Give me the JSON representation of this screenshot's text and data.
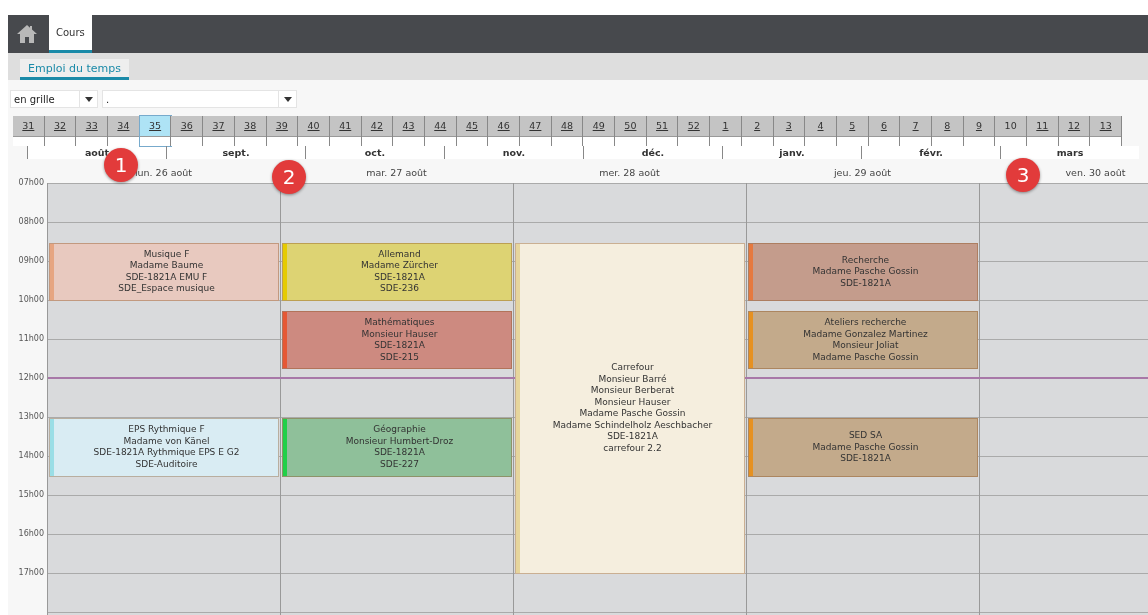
{
  "nav": {
    "tabs": [
      {
        "label": "Cours",
        "selected": true
      }
    ]
  },
  "subtabs": [
    {
      "label": "Emploi du temps",
      "selected": true
    }
  ],
  "filters": [
    {
      "value": "en grille"
    },
    {
      "value": "."
    }
  ],
  "weeks": [
    {
      "label": "31",
      "selected": false,
      "linked": true
    },
    {
      "label": "32",
      "selected": false,
      "linked": true
    },
    {
      "label": "33",
      "selected": false,
      "linked": true
    },
    {
      "label": "34",
      "selected": false,
      "linked": true
    },
    {
      "label": "35",
      "selected": true,
      "linked": true
    },
    {
      "label": "36",
      "selected": false,
      "linked": true
    },
    {
      "label": "37",
      "selected": false,
      "linked": true
    },
    {
      "label": "38",
      "selected": false,
      "linked": true
    },
    {
      "label": "39",
      "selected": false,
      "linked": true
    },
    {
      "label": "40",
      "selected": false,
      "linked": true
    },
    {
      "label": "41",
      "selected": false,
      "linked": true
    },
    {
      "label": "42",
      "selected": false,
      "linked": true
    },
    {
      "label": "43",
      "selected": false,
      "linked": true
    },
    {
      "label": "44",
      "selected": false,
      "linked": true
    },
    {
      "label": "45",
      "selected": false,
      "linked": true
    },
    {
      "label": "46",
      "selected": false,
      "linked": true
    },
    {
      "label": "47",
      "selected": false,
      "linked": true
    },
    {
      "label": "48",
      "selected": false,
      "linked": true
    },
    {
      "label": "49",
      "selected": false,
      "linked": true
    },
    {
      "label": "50",
      "selected": false,
      "linked": true
    },
    {
      "label": "51",
      "selected": false,
      "linked": true
    },
    {
      "label": "52",
      "selected": false,
      "linked": true
    },
    {
      "label": "1",
      "selected": false,
      "linked": true
    },
    {
      "label": "2",
      "selected": false,
      "linked": true
    },
    {
      "label": "3",
      "selected": false,
      "linked": true
    },
    {
      "label": "4",
      "selected": false,
      "linked": true
    },
    {
      "label": "5",
      "selected": false,
      "linked": true
    },
    {
      "label": "6",
      "selected": false,
      "linked": true
    },
    {
      "label": "7",
      "selected": false,
      "linked": true
    },
    {
      "label": "8",
      "selected": false,
      "linked": true
    },
    {
      "label": "9",
      "selected": false,
      "linked": true
    },
    {
      "label": "10",
      "selected": false,
      "linked": false
    },
    {
      "label": "11",
      "selected": false,
      "linked": true
    },
    {
      "label": "12",
      "selected": false,
      "linked": true
    },
    {
      "label": "13",
      "selected": false,
      "linked": true
    }
  ],
  "months": [
    "août",
    "sept.",
    "oct.",
    "nov.",
    "déc.",
    "janv.",
    "févr.",
    "mars"
  ],
  "hours": [
    "07h00",
    "08h00",
    "09h00",
    "10h00",
    "11h00",
    "12h00",
    "13h00",
    "14h00",
    "15h00",
    "16h00",
    "17h00"
  ],
  "days": [
    {
      "label": "lun. 26 août",
      "events": [
        {
          "color": "#e8c9bf",
          "lines": [
            "Musique F",
            "Madame Baume",
            "SDE-1821A EMU F",
            "SDE_Espace musique"
          ]
        },
        {
          "color": "#d9ecf3",
          "lines": [
            "EPS Rythmique F",
            "Madame von Känel",
            "SDE-1821A Rythmique EPS E G2",
            "SDE-Auditoire"
          ]
        }
      ]
    },
    {
      "label": "mar. 27 août",
      "events": [
        {
          "color": "#ddd373",
          "lines": [
            "Allemand",
            "Madame Zürcher",
            "SDE-1821A",
            "SDE-236"
          ]
        },
        {
          "color": "#cd8a80",
          "lines": [
            "Mathématiques",
            "Monsieur Hauser",
            "SDE-1821A",
            "SDE-215"
          ]
        },
        {
          "color": "#8fc09a",
          "lines": [
            "Géographie",
            "Monsieur Humbert-Droz",
            "SDE-1821A",
            "SDE-227"
          ]
        }
      ]
    },
    {
      "label": "mer. 28 août",
      "events": [
        {
          "color": "#f5eede",
          "lines": [
            "Carrefour",
            "Monsieur Barré",
            "Monsieur Berberat",
            "Monsieur Hauser",
            "Madame Pasche Gossin",
            "Madame Schindelholz Aeschbacher",
            "SDE-1821A",
            "carrefour 2.2"
          ]
        }
      ]
    },
    {
      "label": "jeu. 29 août",
      "events": [
        {
          "color": "#c49c8c",
          "lines": [
            "Recherche",
            "Madame Pasche Gossin",
            "SDE-1821A"
          ]
        },
        {
          "color": "#c3aa8b",
          "lines": [
            "Ateliers recherche",
            "Madame Gonzalez Martinez",
            "Monsieur Joliat",
            "Madame Pasche Gossin"
          ]
        },
        {
          "color": "#c3aa8b",
          "lines": [
            "SED SA",
            "Madame Pasche Gossin",
            "SDE-1821A"
          ]
        }
      ]
    },
    {
      "label": "ven. 30 août"
    }
  ],
  "markers": [
    "1",
    "2",
    "3"
  ]
}
